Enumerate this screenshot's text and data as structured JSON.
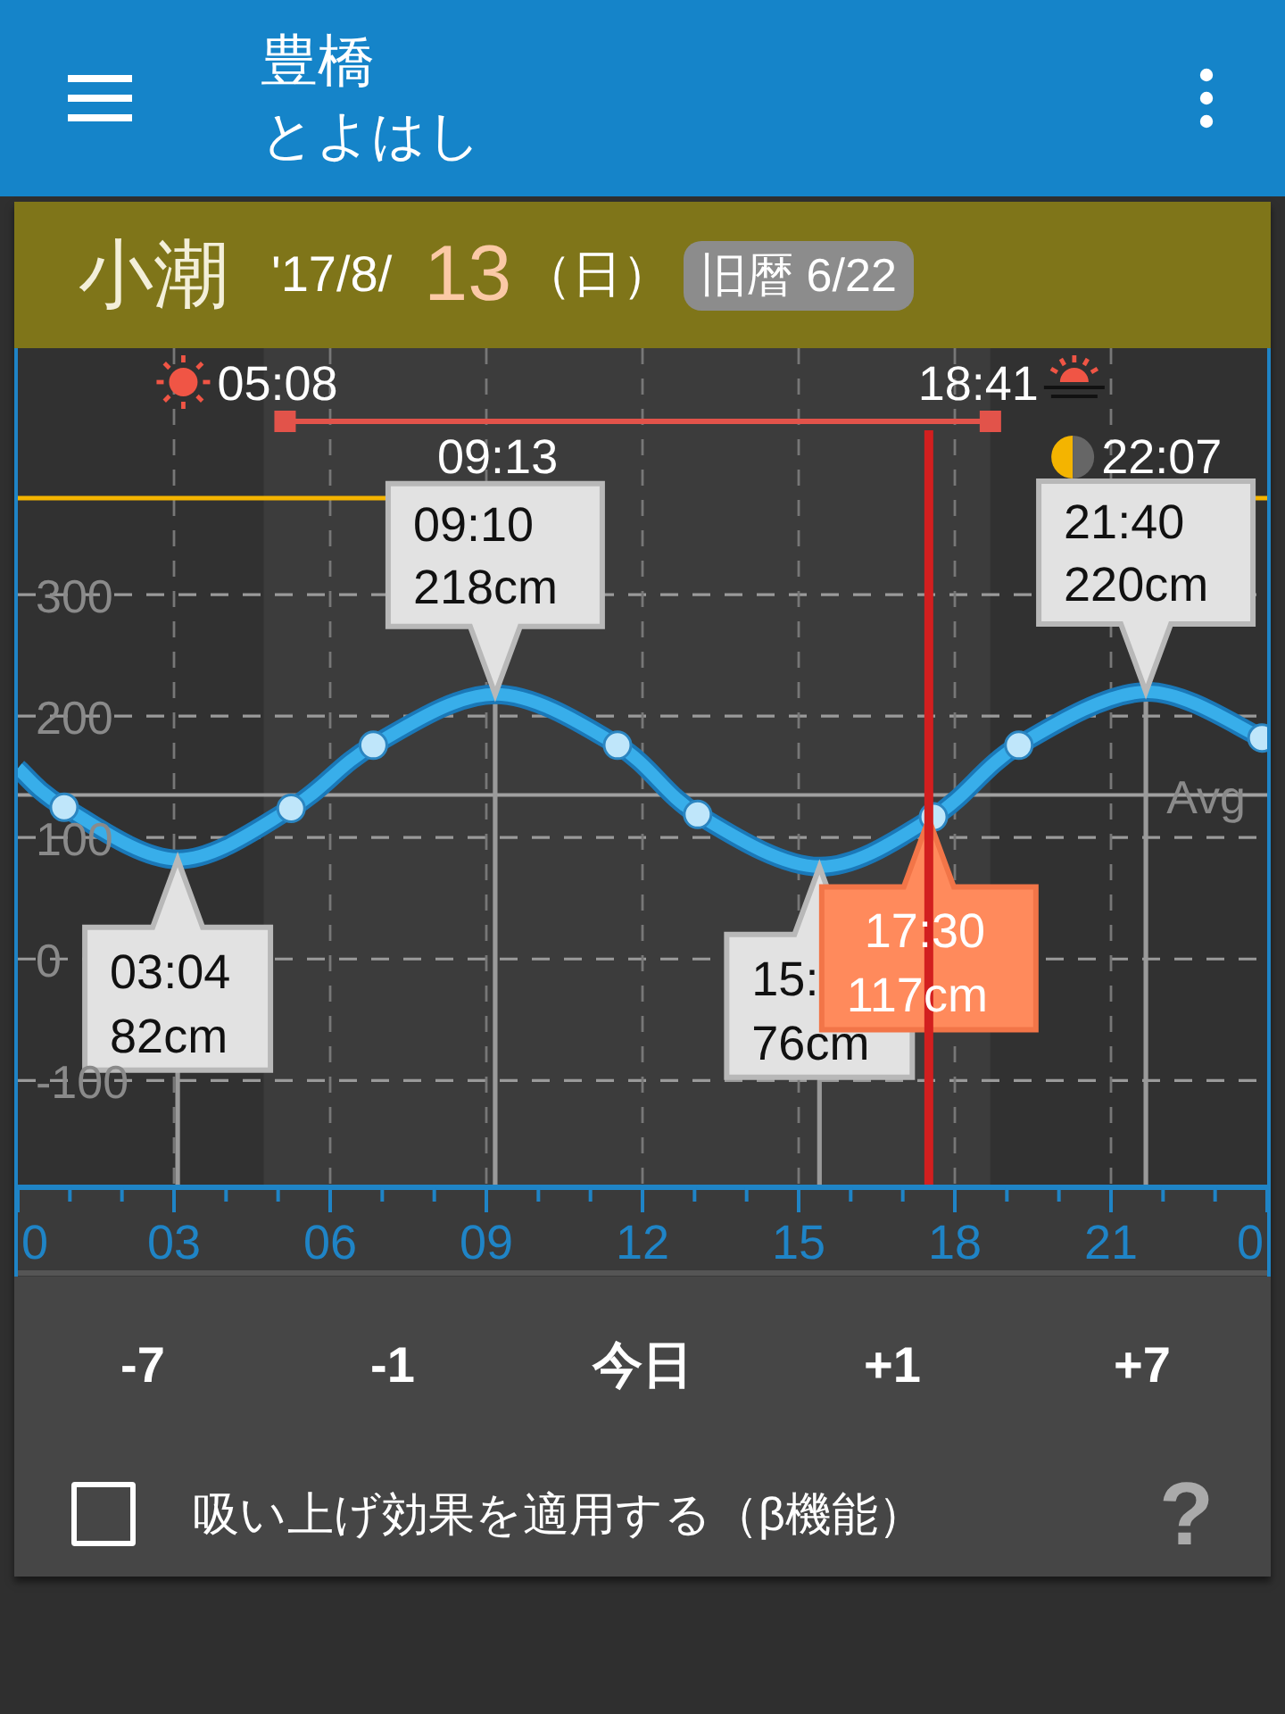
{
  "app_bar": {
    "title": "豊橋",
    "subtitle": "とよはし"
  },
  "day": {
    "tide_name": "小潮",
    "date_prefix": "'17/8/",
    "day": "13",
    "weekday": "（日）",
    "lunar_badge": "旧暦 6/22"
  },
  "chart": {
    "chart_data": {
      "type": "line",
      "grid": true,
      "x": [
        0,
        0.89,
        3.07,
        5.25,
        6.83,
        9.17,
        11.52,
        13.06,
        15.4,
        17.59,
        19.23,
        21.67,
        23.9,
        24
      ],
      "series": [
        {
          "color": "#38aeea",
          "values": [
            157,
            125,
            82,
            124,
            176,
            218,
            176,
            119,
            76,
            117,
            176,
            220,
            182,
            179
          ]
        }
      ],
      "xlim": [
        0,
        24
      ],
      "ylim": [
        -188,
        503
      ],
      "yticks": [
        -100,
        0,
        100,
        200,
        300
      ],
      "xticks": [
        {
          "value": 0,
          "label": "0"
        },
        {
          "value": 3,
          "label": "03"
        },
        {
          "value": 6,
          "label": "06"
        },
        {
          "value": 9,
          "label": "09"
        },
        {
          "value": 12,
          "label": "12"
        },
        {
          "value": 15,
          "label": "15"
        },
        {
          "value": 18,
          "label": "18"
        },
        {
          "value": 21,
          "label": "21"
        }
      ],
      "ref_lines": [
        {
          "axis": "y",
          "value": 135,
          "label": "Avg"
        },
        {
          "axis": "x",
          "value": 17.5,
          "color": "#d21f1f"
        }
      ]
    },
    "next_day_label": "0",
    "sun": {
      "sunrise": "05:08",
      "sunset": "18:41"
    },
    "moon": {
      "moonset": "09:13",
      "moonrise": "22:07"
    },
    "tide_callouts": [
      {
        "kind": "low",
        "time": "03:04",
        "height": "82cm"
      },
      {
        "kind": "high",
        "time": "09:10",
        "height": "218cm"
      },
      {
        "kind": "low",
        "time": "15:",
        "height": "76cm"
      },
      {
        "kind": "high",
        "time": "21:40",
        "height": "220cm"
      }
    ],
    "current": {
      "time": "17:30",
      "height": "117cm"
    }
  },
  "day_buttons": [
    {
      "label": "-7"
    },
    {
      "label": "-1"
    },
    {
      "label": "今日"
    },
    {
      "label": "+1"
    },
    {
      "label": "+7"
    }
  ],
  "options": {
    "label": "吸い上げ効果を適用する（β機能）",
    "checked": false,
    "help": "?"
  }
}
